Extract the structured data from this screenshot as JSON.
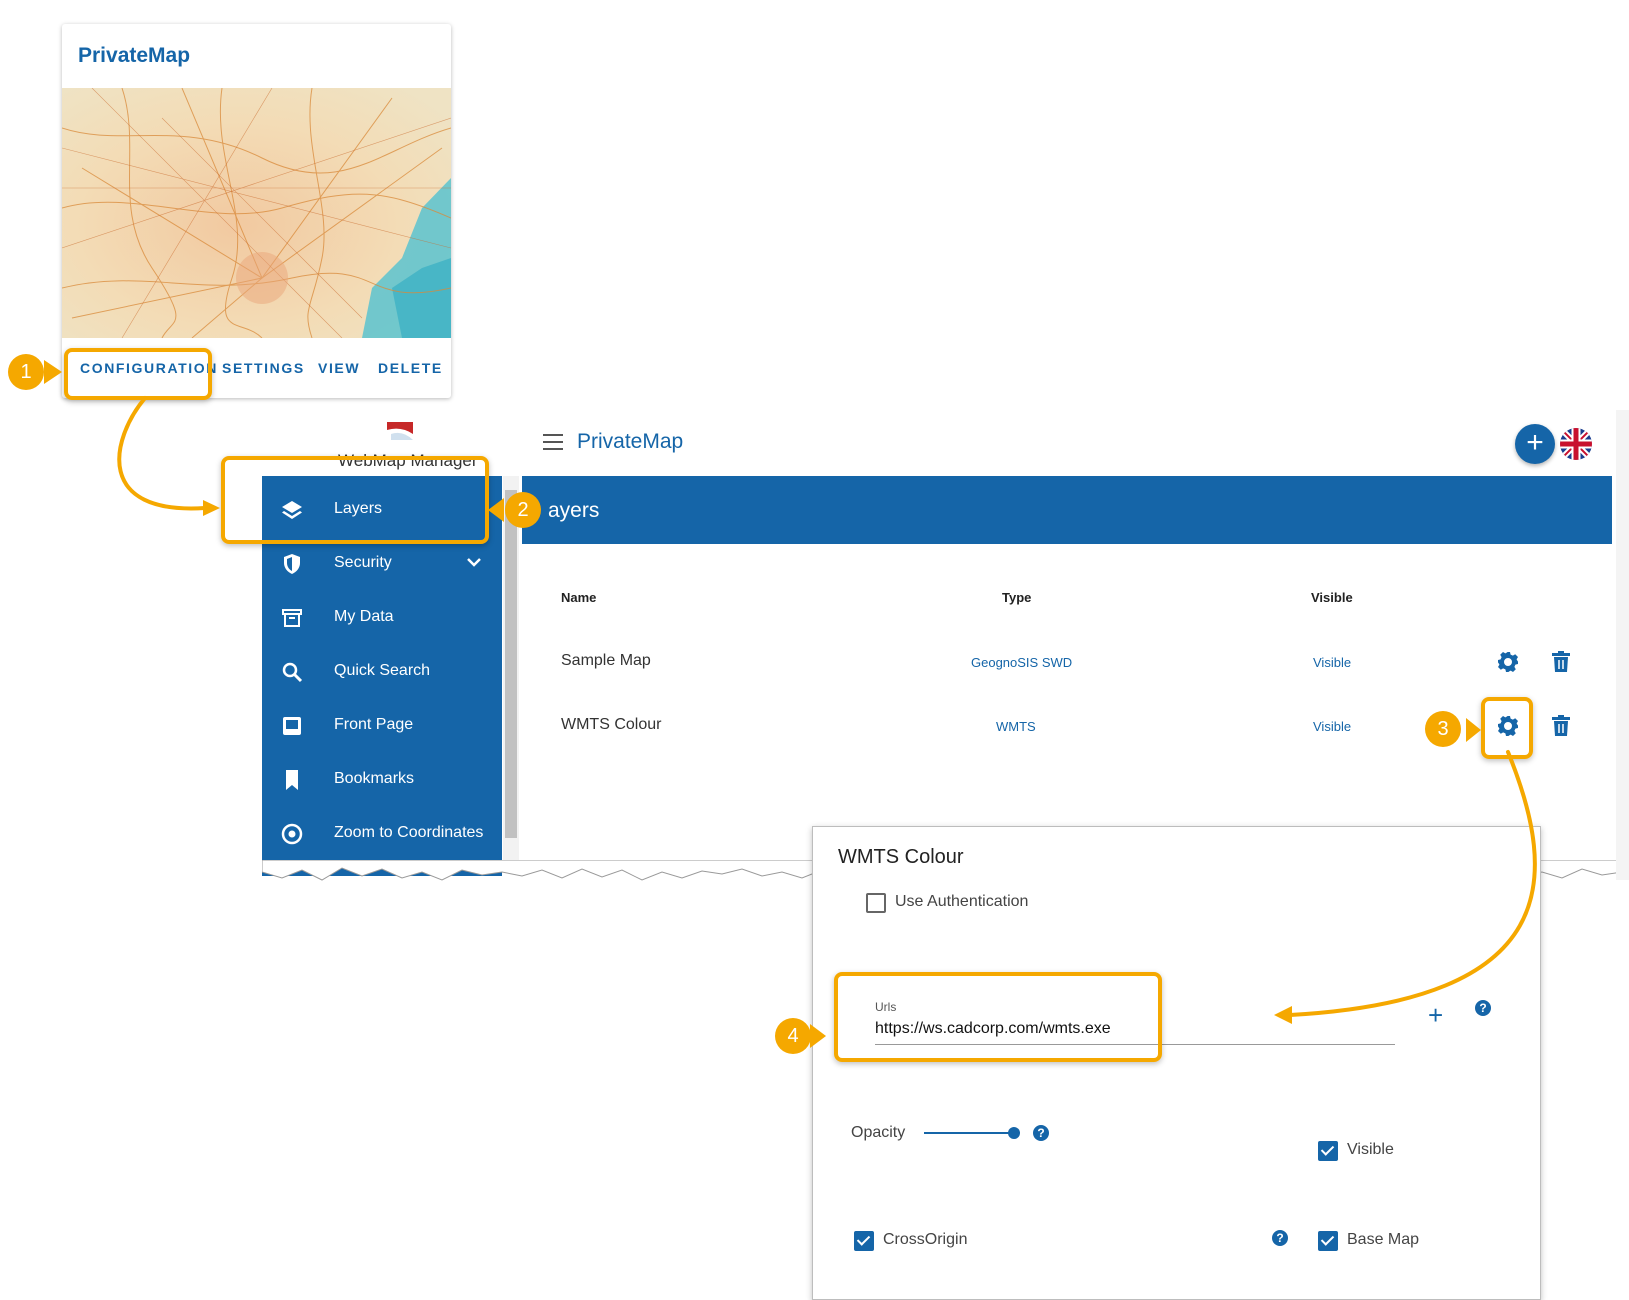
{
  "card": {
    "title": "PrivateMap",
    "actions": [
      "CONFIGURATION",
      "SETTINGS",
      "VIEW",
      "DELETE"
    ]
  },
  "app": {
    "title": "PrivateMap",
    "logo_text": "WebMap Manager",
    "add_icon": "plus-icon",
    "language_icon": "uk-flag-icon",
    "menu_icon": "hamburger-icon"
  },
  "sidebar": {
    "items": [
      {
        "label": "Layers",
        "icon": "layers-icon"
      },
      {
        "label": "Security",
        "icon": "shield-icon"
      },
      {
        "label": "My Data",
        "icon": "archive-icon"
      },
      {
        "label": "Quick Search",
        "icon": "search-icon"
      },
      {
        "label": "Front Page",
        "icon": "front-page-icon"
      },
      {
        "label": "Bookmarks",
        "icon": "bookmark-icon"
      },
      {
        "label": "Zoom to Coordinates",
        "icon": "target-icon"
      }
    ]
  },
  "layers": {
    "header": "ayers",
    "columns": [
      "Name",
      "Type",
      "Visible"
    ],
    "rows": [
      {
        "name": "Sample Map",
        "type": "GeognoSIS SWD",
        "visible": "Visible"
      },
      {
        "name": "WMTS Colour",
        "type": "WMTS",
        "visible": "Visible"
      }
    ]
  },
  "dialog": {
    "title": "WMTS Colour",
    "use_auth_label": "Use Authentication",
    "use_auth_checked": false,
    "urls_label": "Urls",
    "urls_value": "https://ws.cadcorp.com/wmts.exe",
    "opacity_label": "Opacity",
    "opacity_value": 1.0,
    "visible_label": "Visible",
    "visible_checked": true,
    "crossorigin_label": "CrossOrigin",
    "crossorigin_checked": true,
    "basemap_label": "Base Map",
    "basemap_checked": true
  },
  "callouts": [
    "1",
    "2",
    "3",
    "4"
  ],
  "colors": {
    "primary": "#1565a8",
    "accent": "#f5a800"
  }
}
